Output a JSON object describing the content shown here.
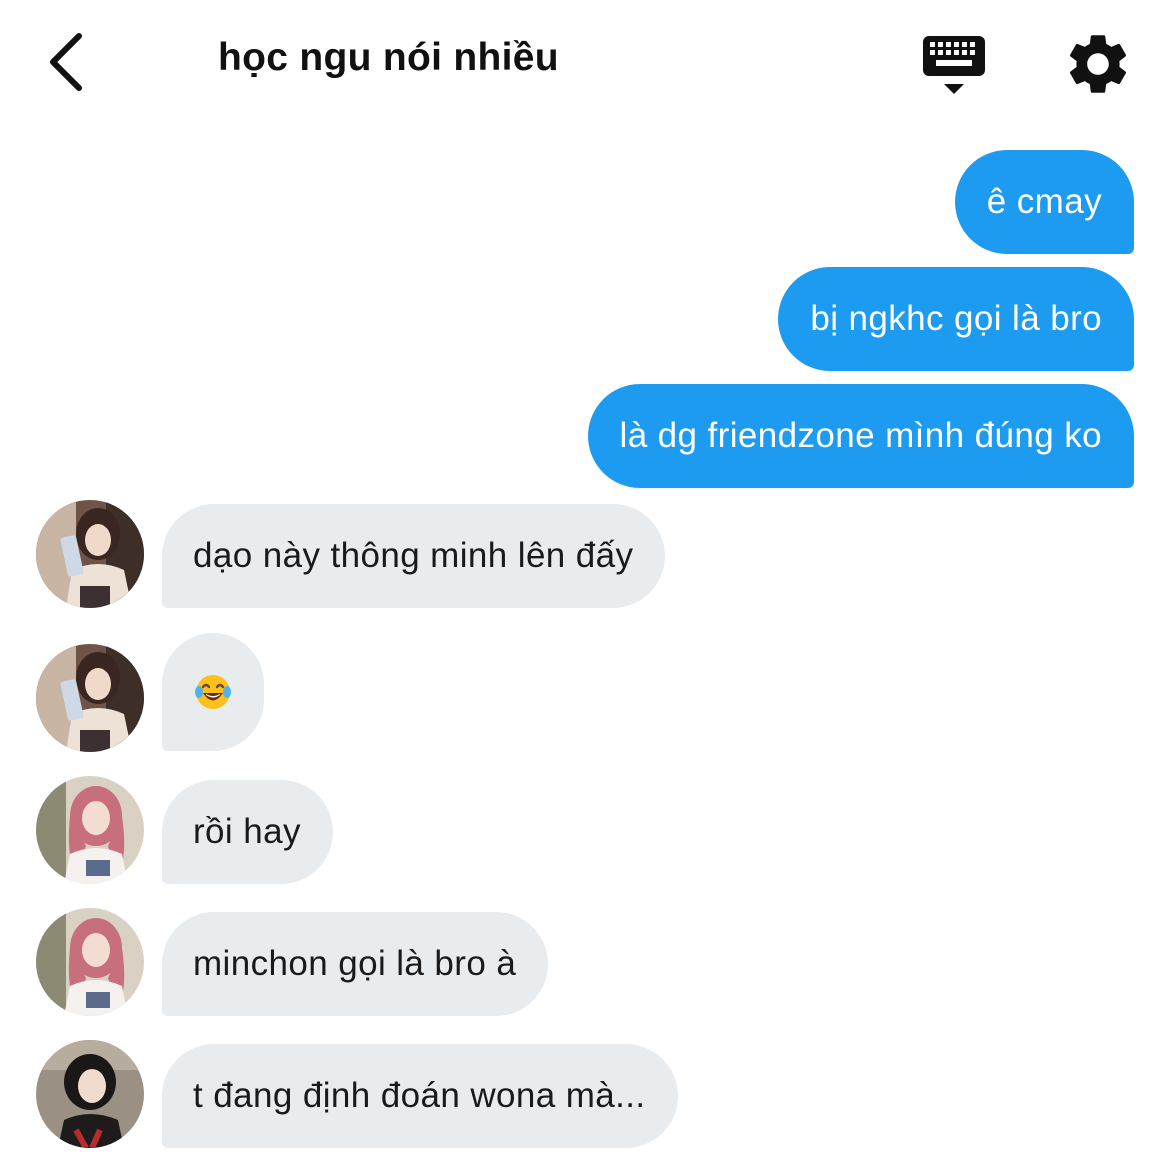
{
  "header": {
    "title": "học ngu nói nhiều",
    "back_icon": "chevron-left-icon",
    "keyboard_icon": "keyboard-icon",
    "settings_icon": "gear-icon"
  },
  "messages": {
    "out": [
      {
        "text": "ê cmay"
      },
      {
        "text": "bị ngkhc gọi là bro"
      },
      {
        "text": "là dg friendzone mình đúng ko"
      }
    ],
    "in": [
      {
        "text": "dạo này thông minh lên đấy",
        "avatar": "avatar-girl-phone"
      },
      {
        "text": "",
        "emoji": "face-with-tears-of-joy",
        "avatar": "avatar-girl-phone"
      },
      {
        "text": "rồi hay",
        "avatar": "avatar-girl-pink-hair"
      },
      {
        "text": "minchon gọi là bro à",
        "avatar": "avatar-girl-pink-hair"
      },
      {
        "text": "t đang định đoán wona mà...",
        "avatar": "avatar-girl-short-hair"
      }
    ]
  },
  "colors": {
    "outgoing_bubble": "#1d9bf0",
    "incoming_bubble": "#e8ecef",
    "background": "#ffffff"
  }
}
